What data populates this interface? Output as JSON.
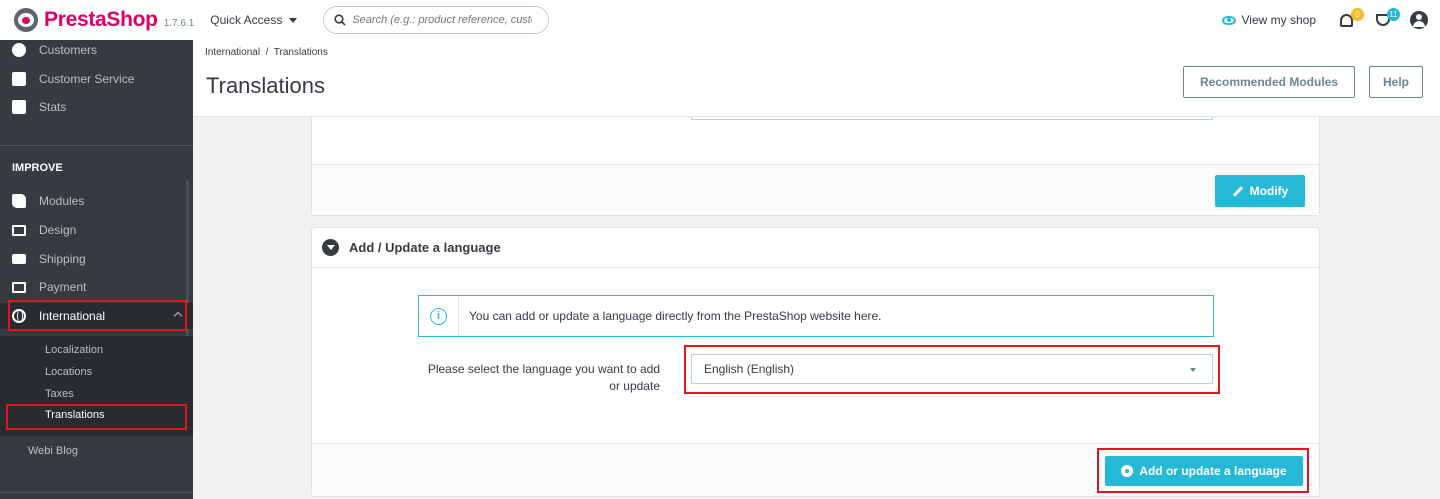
{
  "header": {
    "brand": "PrestaShop",
    "version": "1.7.6.1",
    "quick_access": "Quick Access",
    "search_placeholder": "Search (e.g.: product reference, custome",
    "view_shop": "View my shop",
    "orders_badge": "0",
    "messages_badge": "11"
  },
  "sidebar": {
    "items_top": [
      {
        "label": "Customers",
        "icon": "user-icon"
      },
      {
        "label": "Customer Service",
        "icon": "chat-icon"
      },
      {
        "label": "Stats",
        "icon": "stats-icon"
      }
    ],
    "section": "IMPROVE",
    "items": [
      {
        "label": "Modules",
        "icon": "puzzle-icon"
      },
      {
        "label": "Design",
        "icon": "monitor-icon"
      },
      {
        "label": "Shipping",
        "icon": "truck-icon"
      },
      {
        "label": "Payment",
        "icon": "card-icon"
      },
      {
        "label": "International",
        "icon": "globe-icon"
      }
    ],
    "submenu": [
      "Localization",
      "Locations",
      "Taxes",
      "Translations"
    ],
    "extra": "Webi Blog"
  },
  "page": {
    "breadcrumb": "International  /  Translations",
    "title": "Translations",
    "recommended_modules": "Recommended Modules",
    "help": "Help"
  },
  "panel_modify": {
    "button": "Modify"
  },
  "panel_language": {
    "title": "Add / Update a language",
    "alert_text": "You can add or update a language directly from the PrestaShop website here.",
    "select_label": "Please select the language you want to add or update",
    "selected_language": "English (English)",
    "submit": "Add or update a language"
  },
  "colors": {
    "accent": "#25b9d7",
    "brand": "#df0067",
    "sidebar": "#363a41",
    "highlight": "#e8131e"
  }
}
